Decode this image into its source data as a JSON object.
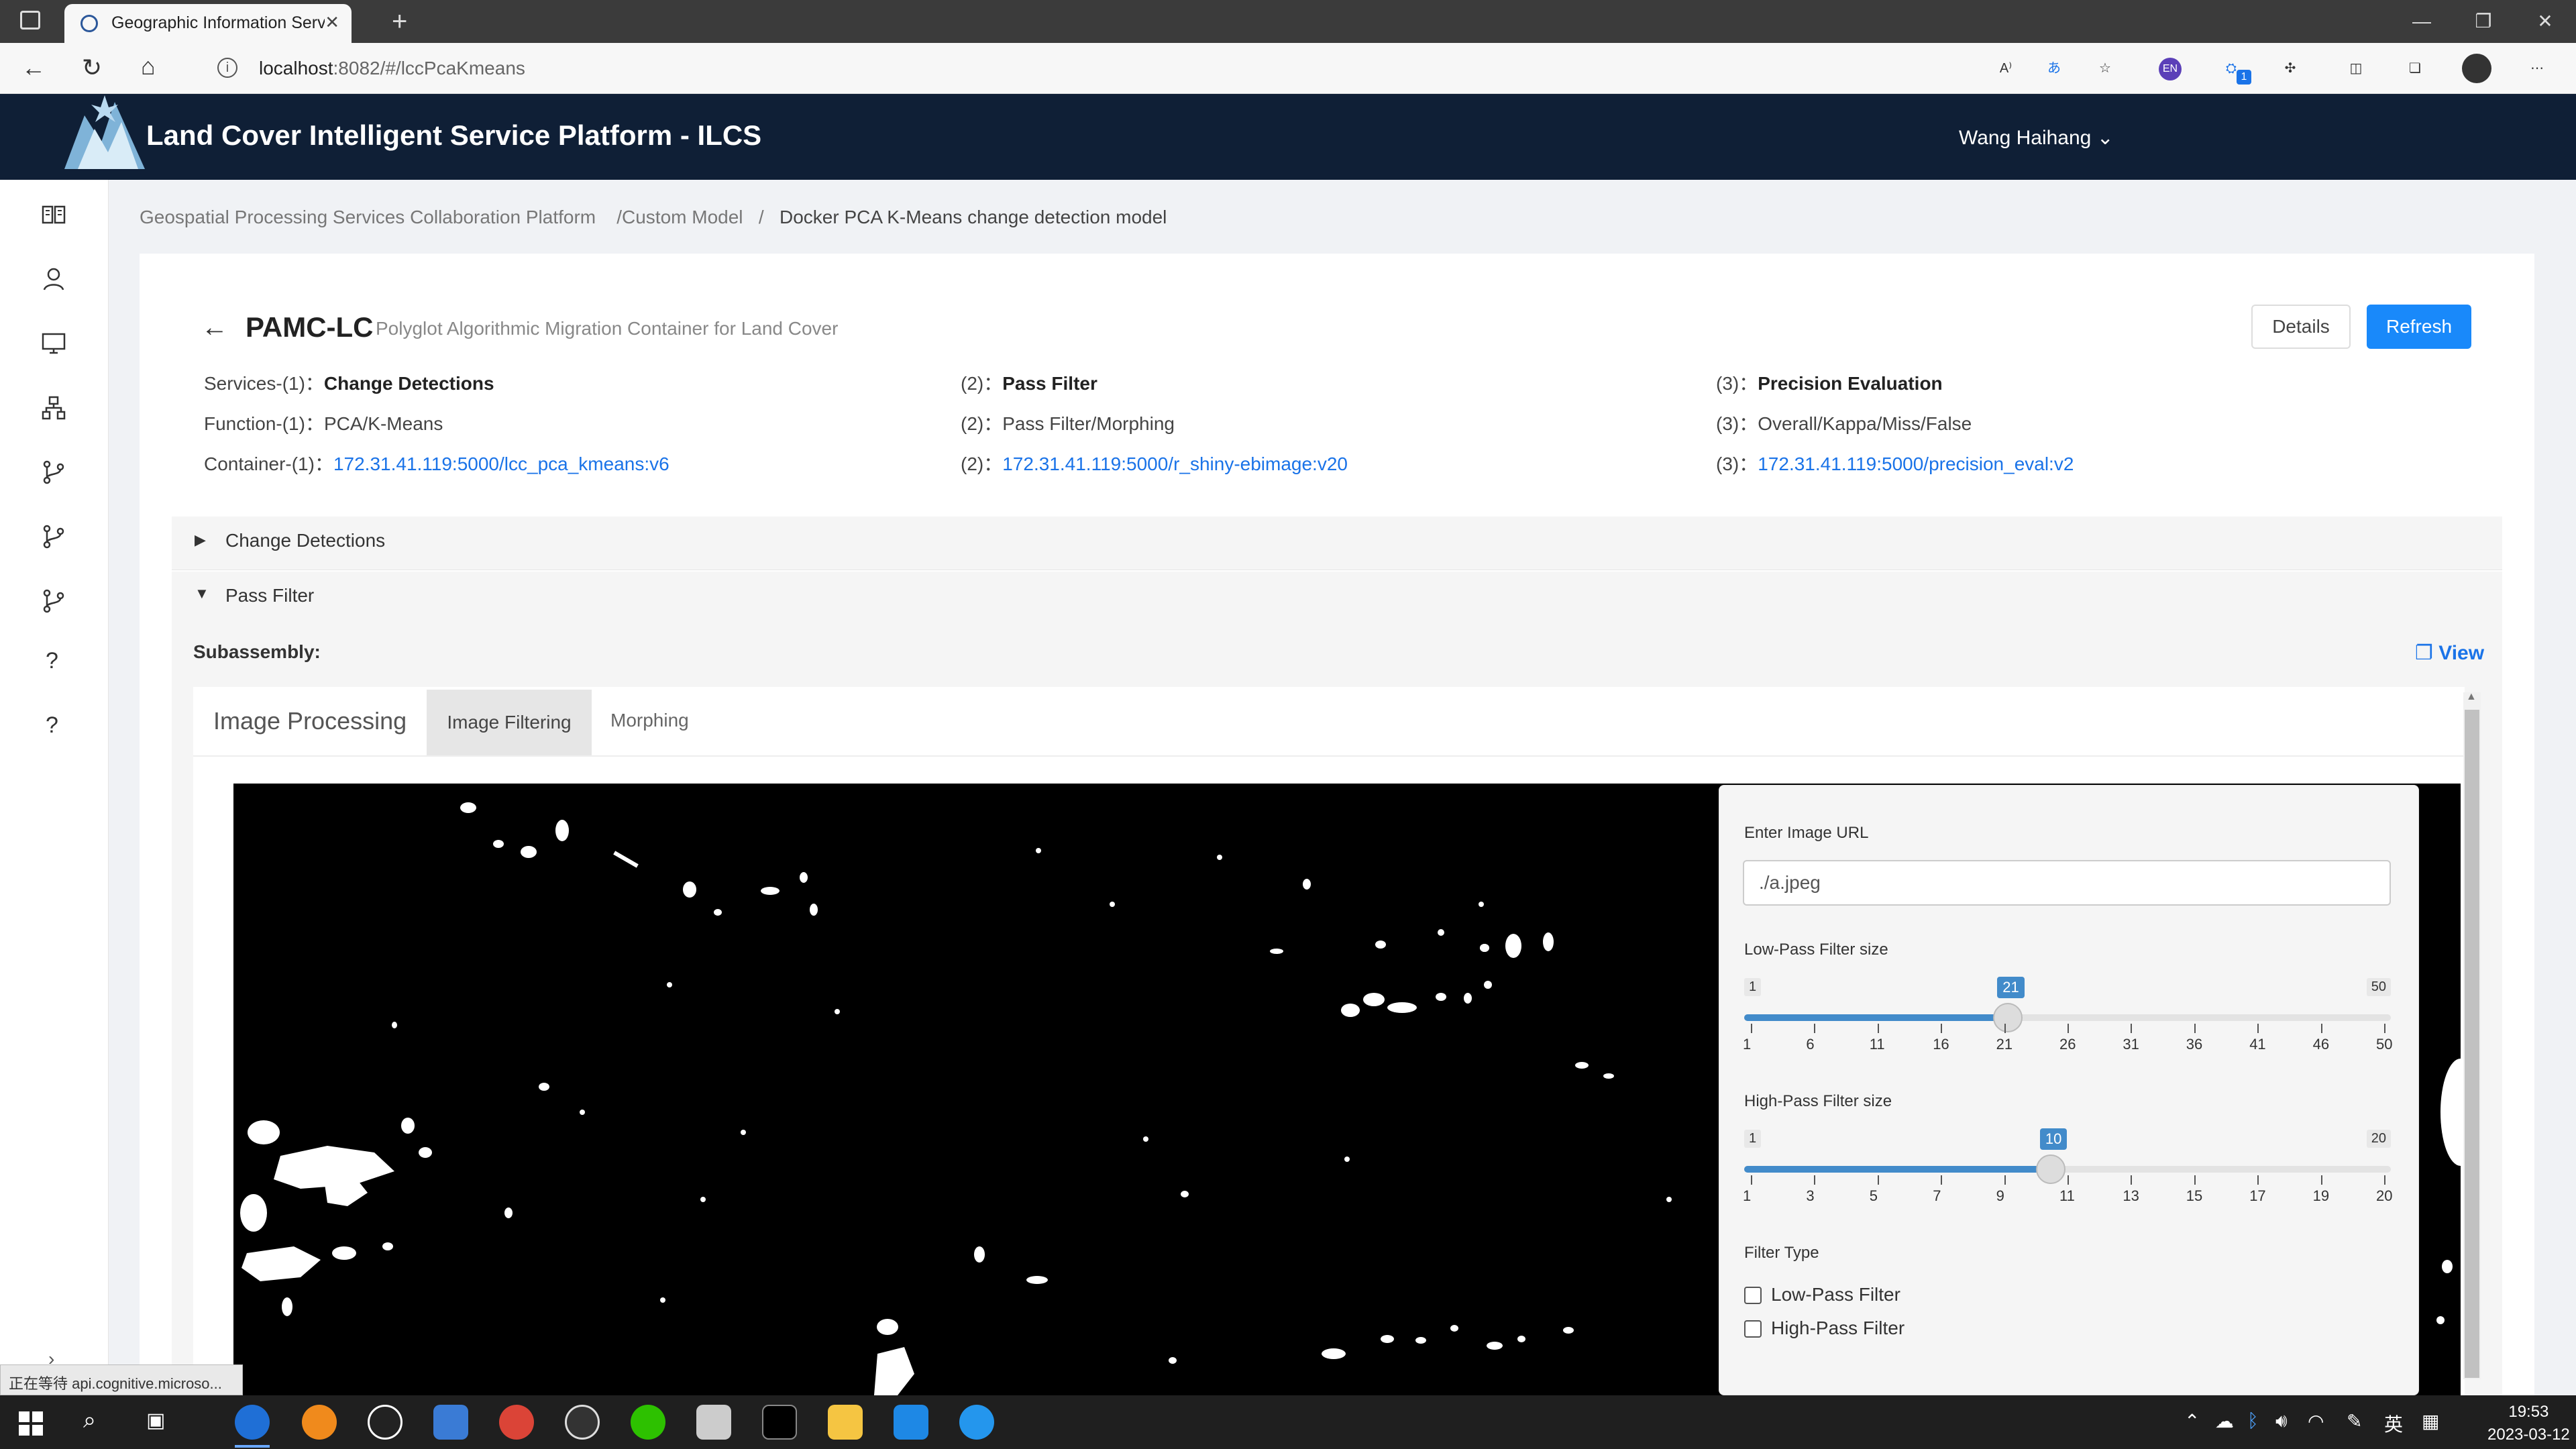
{
  "browser": {
    "tab_title": "Geographic Information Services",
    "url_host": "localhost",
    "url_path": ":8082/#/lccPcaKmeans",
    "ext_badge": "EN",
    "ext_count": "1"
  },
  "app": {
    "title": "Land Cover Intelligent Service Platform - ILCS",
    "user": "Wang Haihang ⌄"
  },
  "breadcrumb": {
    "b1": "Geospatial Processing Services Collaboration Platform",
    "b2": "/Custom Model",
    "sep": "/",
    "b3": "Docker PCA K-Means change detection model"
  },
  "header": {
    "name": "PAMC-LC",
    "subtitle": "Polyglot Algorithmic Migration Container for Land Cover",
    "details_label": "Details",
    "refresh_label": "Refresh"
  },
  "services": {
    "services_label": "Services-(1)：",
    "s1": "Change Detections",
    "s2_label": "(2)：",
    "s2": "Pass Filter",
    "s3_label": "(3)：",
    "s3": "Precision Evaluation",
    "function_label": "Function-(1)：",
    "f1": "PCA/K-Means",
    "f2_label": "(2)：",
    "f2": "Pass Filter/Morphing",
    "f3_label": "(3)：",
    "f3": "Overall/Kappa/Miss/False",
    "container_label": "Container-(1)：",
    "c1": "172.31.41.119:5000/lcc_pca_kmeans:v6",
    "c2_label": "(2)：",
    "c2": "172.31.41.119:5000/r_shiny-ebimage:v20",
    "c3_label": "(3)：",
    "c3": "172.31.41.119:5000/precision_eval:v2"
  },
  "collapse": {
    "item1": "Change Detections",
    "item2": "Pass Filter",
    "subassembly": "Subassembly:",
    "view": "❐ View"
  },
  "inner_tabs": {
    "processing": "Image Processing",
    "filtering": "Image Filtering",
    "morphing": "Morphing"
  },
  "panel": {
    "url_label": "Enter Image URL",
    "url_value": "./a.jpeg",
    "low_label": "Low-Pass Filter size",
    "low": {
      "min": "1",
      "max": "50",
      "value": "21",
      "fraction": 0.408
    },
    "low_ticks": [
      "1",
      "6",
      "11",
      "16",
      "21",
      "26",
      "31",
      "36",
      "41",
      "46",
      "50"
    ],
    "high_label": "High-Pass Filter size",
    "high": {
      "min": "1",
      "max": "20",
      "value": "10",
      "fraction": 0.474
    },
    "high_ticks": [
      "1",
      "3",
      "5",
      "7",
      "9",
      "11",
      "13",
      "15",
      "17",
      "19",
      "20"
    ],
    "filter_type_label": "Filter Type",
    "opt_low": "Low-Pass Filter",
    "opt_high": "High-Pass Filter"
  },
  "status_text": "正在等待 api.cognitive.microso...",
  "clock": {
    "time": "19:53",
    "date": "2023-03-12"
  },
  "tray": {
    "ime": "英"
  },
  "colors": {
    "header_bg": "#0f1f36",
    "primary": "#1989fa",
    "link": "#1a73e8",
    "slider": "#428bca"
  }
}
